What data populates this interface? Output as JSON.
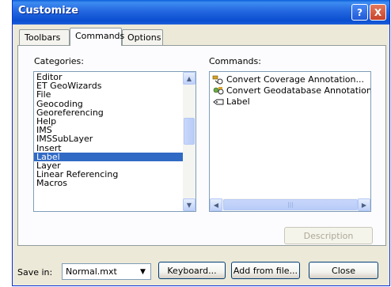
{
  "window": {
    "title": "Customize",
    "help_label": "?",
    "close_label": "X"
  },
  "tabs": [
    {
      "label": "Toolbars"
    },
    {
      "label": "Commands"
    },
    {
      "label": "Options"
    }
  ],
  "categories": {
    "label": "Categories:",
    "items": [
      "Editor",
      "ET GeoWizards",
      "File",
      "Geocoding",
      "Georeferencing",
      "Help",
      "IMS",
      "IMSSubLayer",
      "Insert",
      "Label",
      "Layer",
      "Linear Referencing",
      "Macros"
    ],
    "selected": "Label"
  },
  "commands": {
    "label": "Commands:",
    "items": [
      "Convert Coverage Annotation...",
      "Convert Geodatabase Annotation...",
      "Label"
    ]
  },
  "buttons": {
    "description": "Description",
    "keyboard": "Keyboard...",
    "add_from_file": "Add from file...",
    "close": "Close"
  },
  "save_in": {
    "label": "Save in:",
    "value": "Normal.mxt"
  },
  "scrollbar": {
    "up_glyph": "▲",
    "down_glyph": "▼",
    "left_glyph": "◀",
    "right_glyph": "▶",
    "grip_glyph": "|||"
  },
  "combo_glyph": "▼"
}
